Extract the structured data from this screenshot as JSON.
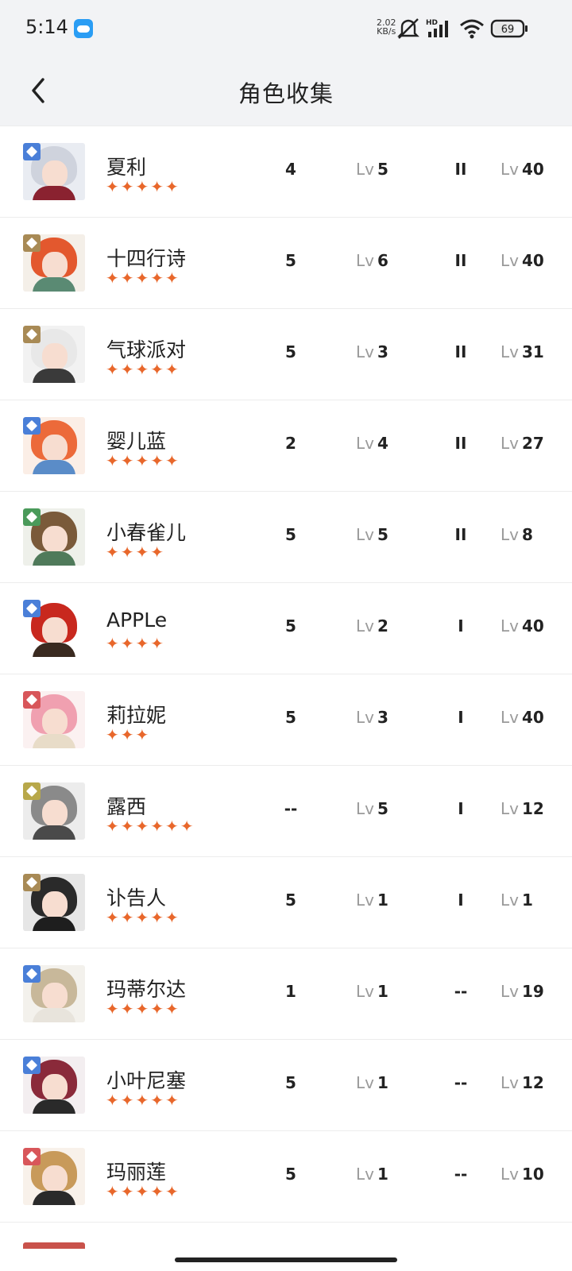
{
  "status_bar": {
    "time": "5:14",
    "speed_value": "2.02",
    "speed_unit": "KB/s",
    "hd_label": "HD",
    "battery": "69"
  },
  "header": {
    "title": "角色收集"
  },
  "stars_glyph": "✦",
  "characters": [
    {
      "name": "夏利",
      "stars": 5,
      "c1": "4",
      "lv1": "5",
      "rank": "II",
      "lv2": "40",
      "badge_color": "#4a7fd8",
      "hair_color": "#cfd3dd",
      "cloth_color": "#8a2230",
      "bg_color": "#e9ecf2"
    },
    {
      "name": "十四行诗",
      "stars": 5,
      "c1": "5",
      "lv1": "6",
      "rank": "II",
      "lv2": "40",
      "badge_color": "#a88a55",
      "hair_color": "#e3582e",
      "cloth_color": "#5a8a73",
      "bg_color": "#f4efe8"
    },
    {
      "name": "气球派对",
      "stars": 5,
      "c1": "5",
      "lv1": "3",
      "rank": "II",
      "lv2": "31",
      "badge_color": "#a88a55",
      "hair_color": "#e8e8e8",
      "cloth_color": "#3a3a3a",
      "bg_color": "#f2f2f2"
    },
    {
      "name": "婴儿蓝",
      "stars": 5,
      "c1": "2",
      "lv1": "4",
      "rank": "II",
      "lv2": "27",
      "badge_color": "#4a7fd8",
      "hair_color": "#ec6a3a",
      "cloth_color": "#5a8cc8",
      "bg_color": "#fbeee6"
    },
    {
      "name": "小春雀儿",
      "stars": 4,
      "c1": "5",
      "lv1": "5",
      "rank": "II",
      "lv2": "8",
      "badge_color": "#4a9a5a",
      "hair_color": "#7a5a3a",
      "cloth_color": "#4f7a5a",
      "bg_color": "#eef0ea"
    },
    {
      "name": "APPLe",
      "stars": 4,
      "c1": "5",
      "lv1": "2",
      "rank": "I",
      "lv2": "40",
      "badge_color": "#4a7fd8",
      "hair_color": "#c8281e",
      "cloth_color": "#3a2a20",
      "bg_color": "#ffffff"
    },
    {
      "name": "莉拉妮",
      "stars": 3,
      "c1": "5",
      "lv1": "3",
      "rank": "I",
      "lv2": "40",
      "badge_color": "#d8565a",
      "hair_color": "#f0a0b0",
      "cloth_color": "#e8dcc8",
      "bg_color": "#fbf1f1"
    },
    {
      "name": "露西",
      "stars": 6,
      "c1": "--",
      "lv1": "5",
      "rank": "I",
      "lv2": "12",
      "badge_color": "#b8a84a",
      "hair_color": "#8a8a8a",
      "cloth_color": "#4a4a4a",
      "bg_color": "#ececec"
    },
    {
      "name": "讣告人",
      "stars": 5,
      "c1": "5",
      "lv1": "1",
      "rank": "I",
      "lv2": "1",
      "badge_color": "#a88a55",
      "hair_color": "#2a2a2a",
      "cloth_color": "#1e1e1e",
      "bg_color": "#e6e6e6"
    },
    {
      "name": "玛蒂尔达",
      "stars": 5,
      "c1": "1",
      "lv1": "1",
      "rank": "--",
      "lv2": "19",
      "badge_color": "#4a7fd8",
      "hair_color": "#c8b89a",
      "cloth_color": "#e8e4dc",
      "bg_color": "#f3f1ec"
    },
    {
      "name": "小叶尼塞",
      "stars": 5,
      "c1": "5",
      "lv1": "1",
      "rank": "--",
      "lv2": "12",
      "badge_color": "#4a7fd8",
      "hair_color": "#8a2a3a",
      "cloth_color": "#2a2a2a",
      "bg_color": "#f3eef0"
    },
    {
      "name": "玛丽莲",
      "stars": 5,
      "c1": "5",
      "lv1": "1",
      "rank": "--",
      "lv2": "10",
      "badge_color": "#d8565a",
      "hair_color": "#c89a5a",
      "cloth_color": "#2a2a2a",
      "bg_color": "#f8f1ea"
    }
  ],
  "lv_prefix": "Lv"
}
